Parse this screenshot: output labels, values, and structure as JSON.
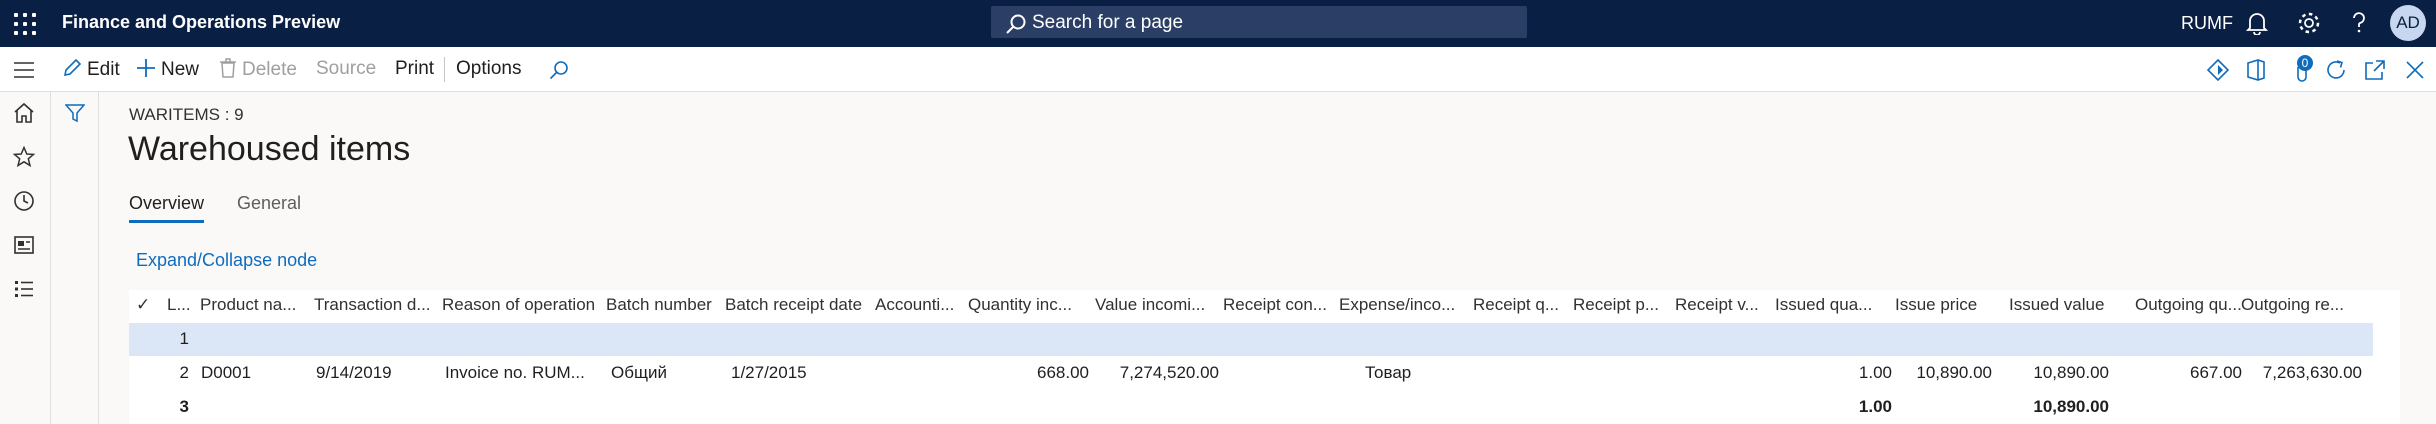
{
  "topbar": {
    "app_title": "Finance and Operations Preview",
    "search_placeholder": "Search for a page",
    "company": "RUMF",
    "avatar_initials": "AD",
    "colors": {
      "background": "#0a1f44",
      "search": "#2b3f66"
    }
  },
  "actions": {
    "edit": "Edit",
    "new": "New",
    "delete": "Delete",
    "source": "Source",
    "print": "Print",
    "options": "Options",
    "badge_count": "0"
  },
  "page": {
    "caption": "WARITEMS : 9",
    "title": "Warehoused items",
    "tabs": [
      "Overview",
      "General"
    ],
    "expand_link": "Expand/Collapse node"
  },
  "grid": {
    "check_mark": "✓",
    "headers": [
      "L...",
      "Product na...",
      "Transaction d...",
      "Reason of operation",
      "Batch number",
      "Batch receipt date",
      "Accounti...",
      "Quantity inc...",
      "Value incomi...",
      "Receipt con...",
      "Expense/inco...",
      "Receipt q...",
      "Receipt p...",
      "Receipt v...",
      "Issued qua...",
      "Issue price",
      "Issued value",
      "Outgoing qu...",
      "Outgoing re..."
    ],
    "rows": [
      {
        "line": "1",
        "product": "",
        "date": "",
        "reason": "",
        "batch": "",
        "batch_date": "",
        "qty_in": "",
        "value_in": "",
        "expense": "",
        "issued_qty": "",
        "issue_price": "",
        "issued_value": "",
        "out_qty": "",
        "out_rem": ""
      },
      {
        "line": "2",
        "product": "D0001",
        "date": "9/14/2019",
        "reason": "Invoice no. RUM...",
        "batch": "Общий",
        "batch_date": "1/27/2015",
        "qty_in": "668.00",
        "value_in": "7,274,520.00",
        "expense": "Товар",
        "issued_qty": "1.00",
        "issue_price": "10,890.00",
        "issued_value": "10,890.00",
        "out_qty": "667.00",
        "out_rem": "7,263,630.00"
      },
      {
        "line": "3",
        "product": "",
        "date": "",
        "reason": "",
        "batch": "",
        "batch_date": "",
        "qty_in": "",
        "value_in": "",
        "expense": "",
        "issued_qty": "1.00",
        "issue_price": "",
        "issued_value": "10,890.00",
        "out_qty": "",
        "out_rem": ""
      }
    ]
  }
}
